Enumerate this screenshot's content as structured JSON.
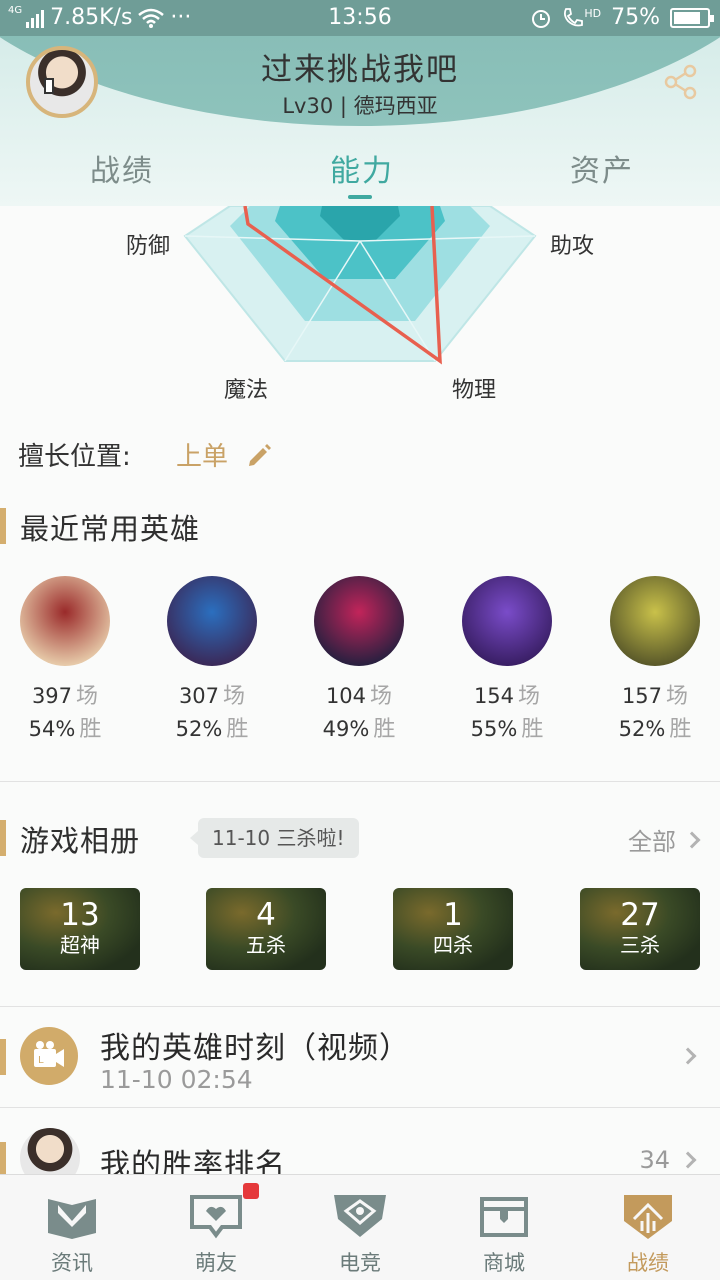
{
  "status_bar": {
    "net": "4G",
    "speed": "7.85K/s",
    "dots": "···",
    "time": "13:56",
    "hd": "HD",
    "battery": "75%"
  },
  "header": {
    "title": "过来挑战我吧",
    "subtitle": "Lv30 | 德玛西亚",
    "tabs": [
      {
        "label": "战绩"
      },
      {
        "label": "能力"
      },
      {
        "label": "资产"
      }
    ],
    "active_tab": 1
  },
  "radar": {
    "labels": {
      "defense": "防御",
      "assist": "助攻",
      "magic": "魔法",
      "physical": "物理"
    }
  },
  "position": {
    "label": "擅长位置:",
    "value": "上单"
  },
  "recent_heroes": {
    "title": "最近常用英雄",
    "heroes": [
      {
        "games": "397",
        "games_unit": "场",
        "win_rate": "54%",
        "win_unit": "胜",
        "colors": [
          "#e6c9a8",
          "#9a2a2a"
        ]
      },
      {
        "games": "307",
        "games_unit": "场",
        "win_rate": "52%",
        "win_unit": "胜",
        "colors": [
          "#3a2a5a",
          "#2b6fbf"
        ]
      },
      {
        "games": "104",
        "games_unit": "场",
        "win_rate": "49%",
        "win_unit": "胜",
        "colors": [
          "#2a2040",
          "#c2245a"
        ]
      },
      {
        "games": "154",
        "games_unit": "场",
        "win_rate": "55%",
        "win_unit": "胜",
        "colors": [
          "#3a1f66",
          "#7a4cc9"
        ]
      },
      {
        "games": "157",
        "games_unit": "场",
        "win_rate": "52%",
        "win_unit": "胜",
        "colors": [
          "#5b5a2a",
          "#c9c14a"
        ]
      }
    ]
  },
  "album": {
    "title": "游戏相册",
    "tip": "11-10 三杀啦!",
    "all_label": "全部",
    "items": [
      {
        "count": "13",
        "label": "超神"
      },
      {
        "count": "4",
        "label": "五杀"
      },
      {
        "count": "1",
        "label": "四杀"
      },
      {
        "count": "27",
        "label": "三杀"
      }
    ]
  },
  "hero_moments": {
    "title": "我的英雄时刻（视频）",
    "time": "11-10 02:54"
  },
  "win_rank": {
    "title": "我的胜率排名",
    "value": "34"
  },
  "bottom_nav": {
    "items": [
      {
        "label": "资讯"
      },
      {
        "label": "萌友"
      },
      {
        "label": "电竞"
      },
      {
        "label": "商城"
      },
      {
        "label": "战绩"
      }
    ],
    "active": 4
  }
}
